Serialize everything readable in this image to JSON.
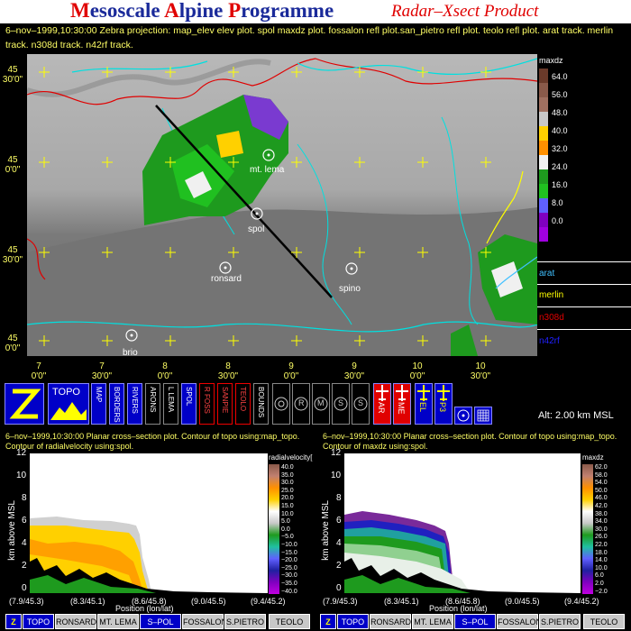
{
  "header": {
    "title_m": "M",
    "title_esoscale": "esoscale ",
    "title_a": "A",
    "title_lpine": "lpine ",
    "title_p": "P",
    "title_rogramme": "rogramme",
    "subtitle": "Radar–Xsect Product"
  },
  "info_line": "6–nov–1999,10:30:00  Zebra projection: map_elev elev plot. spol maxdz plot. fossalon refl plot.san_pietro refl plot. teolo refl plot. arat track. merlin track. n308d track. n42rf track.",
  "map": {
    "lat_labels": [
      {
        "deg": "45",
        "min": "30'0\""
      },
      {
        "deg": "45",
        "min": "0'0\""
      },
      {
        "deg": "45",
        "min": "30'0\""
      },
      {
        "deg": "45",
        "min": "0'0\""
      }
    ],
    "lon_labels": [
      {
        "deg": "7",
        "min": "0'0\""
      },
      {
        "deg": "7",
        "min": "30'0\""
      },
      {
        "deg": "8",
        "min": "0'0\""
      },
      {
        "deg": "8",
        "min": "30'0\""
      },
      {
        "deg": "9",
        "min": "0'0\""
      },
      {
        "deg": "9",
        "min": "30'0\""
      },
      {
        "deg": "10",
        "min": "0'0\""
      },
      {
        "deg": "10",
        "min": "30'0\""
      }
    ],
    "sites": [
      "mt. lema",
      "spol",
      "ronsard",
      "spino",
      "brio"
    ]
  },
  "legend": {
    "title": "maxdz",
    "values": [
      "64.0",
      "56.0",
      "48.0",
      "40.0",
      "32.0",
      "24.0",
      "16.0",
      "8.0",
      "0.0"
    ],
    "colors": [
      "#6a3a2a",
      "#a07060",
      "#c8c8c8",
      "#ffd000",
      "#f0f0f0",
      "#1e9a1e",
      "#20c020",
      "#6060ff",
      "#8000c0"
    ],
    "tracks": [
      {
        "name": "arat",
        "color": "#40c0ff"
      },
      {
        "name": "merlin",
        "color": "#ffff00"
      },
      {
        "name": "n308d",
        "color": "#e00000"
      },
      {
        "name": "n42rf",
        "color": "#2020ff"
      }
    ]
  },
  "toolbar": {
    "topo": "TOPO",
    "vertical_labels": [
      "MAP",
      "BORDERS",
      "RIVERS",
      "ARONS",
      "L LEMA",
      "SPOL",
      "R FOSS",
      "SANPIE",
      "TEOLO",
      "BOUNDS"
    ],
    "red_labels": [
      "AR",
      "ME"
    ],
    "yellow_labels": [
      "EL",
      "P3"
    ],
    "round_labels": [
      "R",
      "M",
      "S",
      "S"
    ],
    "alt": "Alt: 2.00 km MSL"
  },
  "left_plot": {
    "info1": "6–nov–1999,10:30:00  Planar cross–section plot.  Contour of topo using:map_topo.",
    "info2": "Contour of radialvelocity using:spol.",
    "ylabel": "km above MSL",
    "yticks": [
      "12",
      "10",
      "8",
      "6",
      "4",
      "2",
      "0"
    ],
    "xticks": [
      "(7.9/45.3)",
      "(8.3/45.1)",
      "(8.6/45.8)",
      "(9.0/45.5)",
      "(9.4/45.2)"
    ],
    "xlabel": "Position (lon/lat)",
    "scale_title": "radialvelocity[",
    "scale_values": [
      "40.0",
      "35.0",
      "30.0",
      "25.0",
      "20.0",
      "15.0",
      "10.0",
      "5.0",
      "0.0",
      "−5.0",
      "−10.0",
      "−15.0",
      "−20.0",
      "−25.0",
      "−30.0",
      "−35.0",
      "−40.0"
    ]
  },
  "right_plot": {
    "info1": "6–nov–1999,10:30:00  Planar cross–section plot.  Contour of topo using:map_topo.",
    "info2": "Contour of maxdz using:spol.",
    "ylabel": "km above MSL",
    "yticks": [
      "12",
      "10",
      "8",
      "6",
      "4",
      "2",
      "0"
    ],
    "xticks": [
      "(7.9/45.3)",
      "(8.3/45.1)",
      "(8.6/45.8)",
      "(9.0/45.5)",
      "(9.4/45.2)"
    ],
    "xlabel": "Position (lon/lat)",
    "scale_title": "maxdz",
    "scale_values": [
      "62.0",
      "58.0",
      "54.0",
      "50.0",
      "46.0",
      "42.0",
      "38.0",
      "34.0",
      "30.0",
      "26.0",
      "22.0",
      "18.0",
      "14.0",
      "10.0",
      "6.0",
      "2.0",
      "−2.0"
    ]
  },
  "bottom_bar": {
    "left": [
      "TOPO",
      "RONSARD",
      "MT. LEMA",
      "S–POL",
      "FOSSALON",
      "S.PIETRO",
      "TEOLO"
    ],
    "right": [
      "TOPO",
      "RONSARD",
      "MT. LEMA",
      "S–POL",
      "FOSSALON",
      "S.PIETRO",
      "TEOLO"
    ]
  }
}
